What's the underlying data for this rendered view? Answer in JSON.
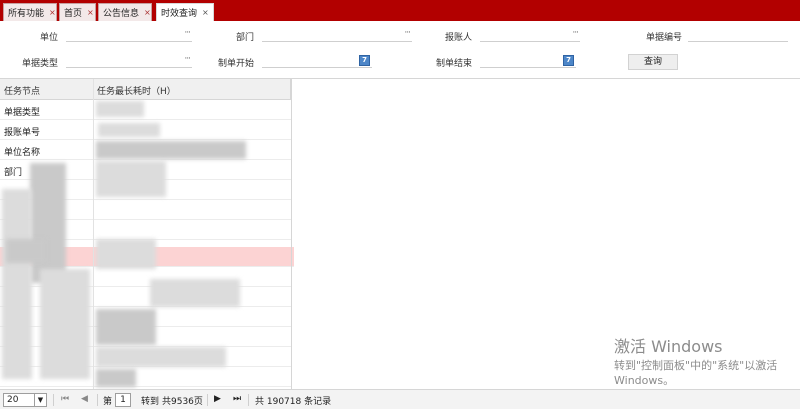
{
  "tabs": [
    {
      "label": "所有功能",
      "close": "×"
    },
    {
      "label": "首页",
      "close": "×"
    },
    {
      "label": "公告信息",
      "close": "×"
    },
    {
      "label": "时效查询",
      "close": "×"
    }
  ],
  "filters": {
    "unit_label": "单位",
    "dept_label": "部门",
    "reporter_label": "报账人",
    "doc_no_label": "单据编号",
    "doc_type_label": "单据类型",
    "start_label": "制单开始",
    "end_label": "制单结束",
    "dots": "···",
    "calendar_glyph": "7",
    "query_button": "查询"
  },
  "grid": {
    "col1_header": "任务节点",
    "col2_header": "任务最长耗时（H）",
    "rows": [
      "单据类型",
      "报账单号",
      "单位名称",
      "部门"
    ]
  },
  "pager": {
    "page_size": "20",
    "page_prefix": "第",
    "page_number": "1",
    "goto_text": "转到",
    "total_pages": "共9536页",
    "total_records": "共 190718 条记录",
    "icons": {
      "first": "⏮",
      "prev": "◀",
      "next": "▶",
      "last": "⏭"
    }
  },
  "watermark": {
    "line1": "激活 Windows",
    "line2": "转到\"控制面板\"中的\"系统\"以激活",
    "line3": "Windows。"
  },
  "colors": {
    "tabbar": "#b20000",
    "highlight_row": "#fcd3d3"
  }
}
